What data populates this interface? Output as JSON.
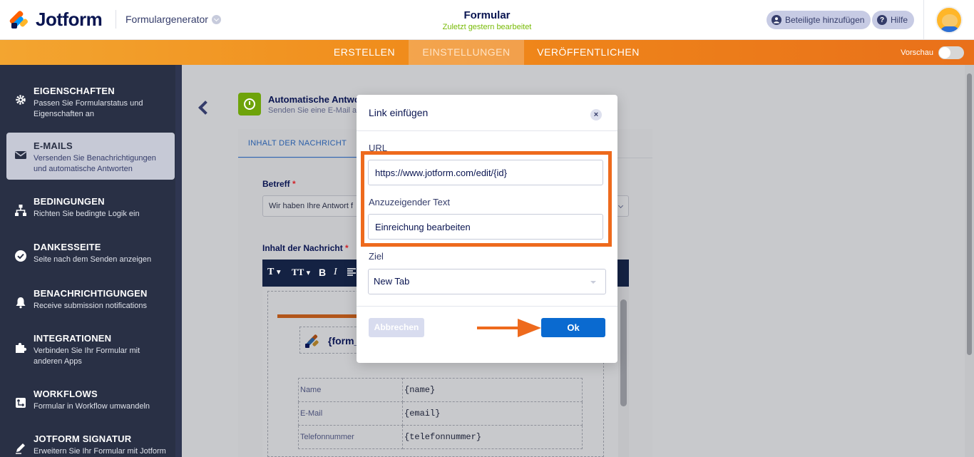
{
  "header": {
    "logo_text": "Jotform",
    "builder_label": "Formulargenerator",
    "form_title": "Formular",
    "form_subtitle": "Zuletzt gestern bearbeitet",
    "add_participants_label": "Beteiligte hinzufügen",
    "help_label": "Hilfe",
    "help_icon_glyph": "?"
  },
  "nav": {
    "tabs": [
      {
        "label": "ERSTELLEN"
      },
      {
        "label": "EINSTELLUNGEN"
      },
      {
        "label": "VERÖFFENTLICHEN"
      }
    ],
    "active_tab": "EINSTELLUNGEN",
    "preview_label": "Vorschau"
  },
  "sidebar": {
    "items": [
      {
        "title": "EIGENSCHAFTEN",
        "desc": "Passen Sie Formularstatus und Eigenschaften an",
        "icon": "gear-icon"
      },
      {
        "title": "E-MAILS",
        "desc": "Versenden Sie Benachrichtigungen und automatische Antworten",
        "icon": "envelope-icon"
      },
      {
        "title": "BEDINGUNGEN",
        "desc": "Richten Sie bedingte Logik ein",
        "icon": "sitemap-icon"
      },
      {
        "title": "DANKESSEITE",
        "desc": "Seite nach dem Senden anzeigen",
        "icon": "check-circle-icon"
      },
      {
        "title": "BENACHRICHTIGUNGEN",
        "desc": "Receive submission notifications",
        "icon": "bell-icon"
      },
      {
        "title": "INTEGRATIONEN",
        "desc": "Verbinden Sie Ihr Formular mit anderen Apps",
        "icon": "puzzle-icon"
      },
      {
        "title": "WORKFLOWS",
        "desc": "Formular in Workflow umwandeln",
        "icon": "workflow-icon"
      },
      {
        "title": "JOTFORM SIGNATUR",
        "desc": "Erweitern Sie Ihr Formular mit Jotform",
        "icon": "pen-icon"
      }
    ],
    "active_item": "E-MAILS"
  },
  "main": {
    "section_title": "Automatische Antwor",
    "section_subtitle": "Senden Sie eine E-Mail an",
    "content_tab": "INHALT DER NACHRICHT",
    "subject_label": "Betreff",
    "subject_value": "Wir haben Ihre Antwort f",
    "required_mark": "*",
    "message_label": "Inhalt der Nachricht",
    "toolbar": {
      "font": "T",
      "size": "TT",
      "bold": "B",
      "italic": "I"
    },
    "template_title": "{form_",
    "table_rows": [
      {
        "key": "Name",
        "value": "{name}"
      },
      {
        "key": "E-Mail",
        "value": "{email}"
      },
      {
        "key": "Telefonnummer",
        "value": "{telefonnummer}"
      }
    ]
  },
  "modal": {
    "title": "Link einfügen",
    "close_glyph": "×",
    "url_label": "URL",
    "url_value": "https://www.jotform.com/edit/{id}",
    "display_text_label": "Anzuzeigender Text",
    "display_text_value": "Einreichung bearbeiten",
    "target_label": "Ziel",
    "target_value": "New Tab",
    "cancel_label": "Abbrechen",
    "ok_label": "Ok"
  },
  "colors": {
    "brand_orange": "#f08a1a",
    "highlight_orange": "#ee6a1d",
    "ok_blue": "#0a6ad0",
    "sidebar_bg": "#293045",
    "accent_green": "#78bb07",
    "navy": "#0a1551"
  }
}
